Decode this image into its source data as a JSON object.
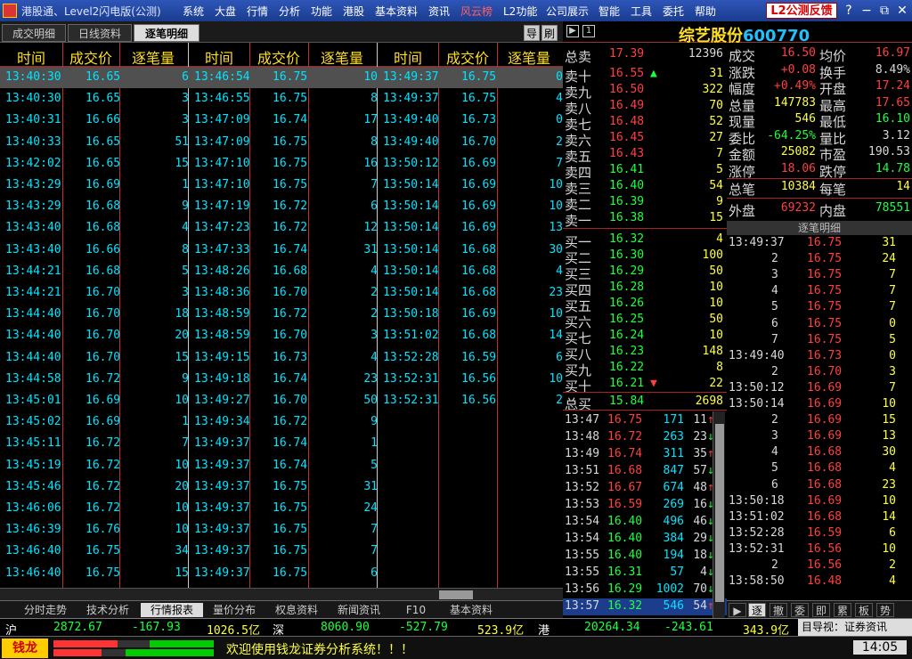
{
  "app": {
    "title": "港股通、Level2闪电版(公测)",
    "menu": [
      "系统",
      "大盘",
      "行情",
      "分析",
      "功能",
      "港股",
      "基本资料",
      "资讯",
      "风云榜",
      "L2功能",
      "公司展示",
      "智能",
      "工具",
      "委托",
      "帮助"
    ],
    "feedback": "L2公测反馈",
    "help": "?",
    "min": "−",
    "restore": "⧉",
    "close": "✕"
  },
  "tabs": [
    "成交明细",
    "日线资料",
    "逐笔明细"
  ],
  "small_btns": [
    "导",
    "刷"
  ],
  "headers": [
    "时间",
    "成交价",
    "逐笔量",
    "时间",
    "成交价",
    "逐笔量",
    "时间",
    "成交价",
    "逐笔量"
  ],
  "col1": [
    [
      "13:40:30",
      "16.65",
      "6"
    ],
    [
      "13:40:30",
      "16.65",
      "3"
    ],
    [
      "13:40:31",
      "16.66",
      "3"
    ],
    [
      "13:40:33",
      "16.65",
      "51"
    ],
    [
      "13:42:02",
      "16.65",
      "15"
    ],
    [
      "13:43:29",
      "16.69",
      "1"
    ],
    [
      "13:43:29",
      "16.68",
      "9"
    ],
    [
      "13:43:40",
      "16.68",
      "4"
    ],
    [
      "13:43:40",
      "16.66",
      "8"
    ],
    [
      "13:44:21",
      "16.68",
      "5"
    ],
    [
      "13:44:21",
      "16.70",
      "3"
    ],
    [
      "13:44:40",
      "16.70",
      "18"
    ],
    [
      "13:44:40",
      "16.70",
      "20"
    ],
    [
      "13:44:40",
      "16.70",
      "15"
    ],
    [
      "13:44:58",
      "16.72",
      "9"
    ],
    [
      "13:45:01",
      "16.69",
      "10"
    ],
    [
      "13:45:02",
      "16.69",
      "1"
    ],
    [
      "13:45:11",
      "16.72",
      "7"
    ],
    [
      "13:45:19",
      "16.72",
      "10"
    ],
    [
      "13:45:46",
      "16.72",
      "20"
    ],
    [
      "13:46:06",
      "16.72",
      "10"
    ],
    [
      "13:46:39",
      "16.76",
      "10"
    ],
    [
      "13:46:40",
      "16.75",
      "34"
    ],
    [
      "13:46:40",
      "16.75",
      "15"
    ]
  ],
  "col2": [
    [
      "13:46:54",
      "16.75",
      "10"
    ],
    [
      "13:46:55",
      "16.75",
      "8"
    ],
    [
      "13:47:09",
      "16.74",
      "17"
    ],
    [
      "13:47:09",
      "16.75",
      "8"
    ],
    [
      "13:47:10",
      "16.75",
      "16"
    ],
    [
      "13:47:10",
      "16.75",
      "7"
    ],
    [
      "13:47:19",
      "16.72",
      "6"
    ],
    [
      "13:47:23",
      "16.72",
      "12"
    ],
    [
      "13:47:33",
      "16.74",
      "31"
    ],
    [
      "13:48:26",
      "16.68",
      "4"
    ],
    [
      "13:48:36",
      "16.70",
      "2"
    ],
    [
      "13:48:59",
      "16.72",
      "2"
    ],
    [
      "13:48:59",
      "16.70",
      "3"
    ],
    [
      "13:49:15",
      "16.73",
      "4"
    ],
    [
      "13:49:18",
      "16.74",
      "23"
    ],
    [
      "13:49:27",
      "16.70",
      "50"
    ],
    [
      "13:49:34",
      "16.72",
      "9"
    ],
    [
      "13:49:37",
      "16.74",
      "1"
    ],
    [
      "13:49:37",
      "16.74",
      "5"
    ],
    [
      "13:49:37",
      "16.75",
      "31"
    ],
    [
      "13:49:37",
      "16.75",
      "24"
    ],
    [
      "13:49:37",
      "16.75",
      "7"
    ],
    [
      "13:49:37",
      "16.75",
      "7"
    ],
    [
      "13:49:37",
      "16.75",
      "6"
    ]
  ],
  "col3": [
    [
      "13:49:37",
      "16.75",
      "0"
    ],
    [
      "13:49:37",
      "16.75",
      "4"
    ],
    [
      "13:49:40",
      "16.73",
      "0"
    ],
    [
      "13:49:40",
      "16.70",
      "2"
    ],
    [
      "13:50:12",
      "16.69",
      "7"
    ],
    [
      "13:50:14",
      "16.69",
      "10"
    ],
    [
      "13:50:14",
      "16.69",
      "10"
    ],
    [
      "13:50:14",
      "16.69",
      "13"
    ],
    [
      "13:50:14",
      "16.68",
      "30"
    ],
    [
      "13:50:14",
      "16.68",
      "4"
    ],
    [
      "13:50:14",
      "16.68",
      "23"
    ],
    [
      "13:50:18",
      "16.69",
      "10"
    ],
    [
      "13:51:02",
      "16.68",
      "14"
    ],
    [
      "13:52:28",
      "16.59",
      "6"
    ],
    [
      "13:52:31",
      "16.56",
      "10"
    ],
    [
      "13:52:31",
      "16.56",
      "2"
    ]
  ],
  "stock": {
    "name": "综艺股份",
    "code": "600770"
  },
  "sell_total": {
    "label": "总卖",
    "price": "17.39",
    "vol": "12396"
  },
  "asks": [
    [
      "卖十",
      "16.55",
      "31"
    ],
    [
      "卖九",
      "16.50",
      "322"
    ],
    [
      "卖八",
      "16.49",
      "70"
    ],
    [
      "卖七",
      "16.48",
      "52"
    ],
    [
      "卖六",
      "16.45",
      "27"
    ],
    [
      "卖五",
      "16.43",
      "7"
    ],
    [
      "卖四",
      "16.41",
      "5"
    ],
    [
      "卖三",
      "16.40",
      "54"
    ],
    [
      "卖二",
      "16.39",
      "9"
    ],
    [
      "卖一",
      "16.38",
      "15"
    ]
  ],
  "bids": [
    [
      "买一",
      "16.32",
      "4"
    ],
    [
      "买二",
      "16.30",
      "100"
    ],
    [
      "买三",
      "16.29",
      "50"
    ],
    [
      "买四",
      "16.28",
      "10"
    ],
    [
      "买五",
      "16.26",
      "10"
    ],
    [
      "买六",
      "16.25",
      "50"
    ],
    [
      "买七",
      "16.24",
      "10"
    ],
    [
      "买八",
      "16.23",
      "148"
    ],
    [
      "买九",
      "16.22",
      "8"
    ],
    [
      "买十",
      "16.21",
      "22"
    ]
  ],
  "buy_total": {
    "label": "总买",
    "price": "15.84",
    "vol": "2698"
  },
  "stats": [
    [
      "成交",
      "16.50",
      "均价",
      "16.97"
    ],
    [
      "涨跌",
      "+0.08",
      "换手",
      "8.49%"
    ],
    [
      "幅度",
      "+0.49%",
      "开盘",
      "17.24"
    ],
    [
      "总量",
      "147783",
      "最高",
      "17.65"
    ],
    [
      "现量",
      "546",
      "最低",
      "16.10"
    ],
    [
      "委比",
      "-64.25%",
      "量比",
      "3.12"
    ],
    [
      "金额",
      "25082",
      "市盈",
      "190.53"
    ],
    [
      "涨停",
      "18.06",
      "跌停",
      "14.78"
    ]
  ],
  "zongbi": [
    "总笔",
    "10384",
    "每笔",
    "14"
  ],
  "waipan": [
    "外盘",
    "69232",
    "内盘",
    "78551"
  ],
  "sub_title": "逐笔明细",
  "ticks": [
    [
      "13:49:37",
      "16.75",
      "31"
    ],
    [
      "2",
      "16.75",
      "24"
    ],
    [
      "3",
      "16.75",
      "7"
    ],
    [
      "4",
      "16.75",
      "7"
    ],
    [
      "5",
      "16.75",
      "7"
    ],
    [
      "6",
      "16.75",
      "0"
    ],
    [
      "7",
      "16.75",
      "5"
    ],
    [
      "13:49:40",
      "16.73",
      "0"
    ],
    [
      "2",
      "16.70",
      "3"
    ],
    [
      "13:50:12",
      "16.69",
      "7"
    ],
    [
      "13:50:14",
      "16.69",
      "10"
    ],
    [
      "2",
      "16.69",
      "15"
    ],
    [
      "3",
      "16.69",
      "13"
    ],
    [
      "4",
      "16.68",
      "30"
    ],
    [
      "5",
      "16.68",
      "4"
    ],
    [
      "6",
      "16.68",
      "23"
    ],
    [
      "13:50:18",
      "16.69",
      "10"
    ],
    [
      "13:51:02",
      "16.68",
      "14"
    ],
    [
      "13:52:28",
      "16.59",
      "6"
    ],
    [
      "13:52:31",
      "16.56",
      "10"
    ],
    [
      "2",
      "16.56",
      "2"
    ],
    [
      "13:58:50",
      "16.48",
      "4"
    ]
  ],
  "hist": [
    [
      "13:47",
      "16.75",
      "171",
      "11"
    ],
    [
      "13:48",
      "16.72",
      "263",
      "23"
    ],
    [
      "13:49",
      "16.74",
      "311",
      "35"
    ],
    [
      "13:51",
      "16.68",
      "847",
      "57"
    ],
    [
      "13:52",
      "16.67",
      "674",
      "48"
    ],
    [
      "13:53",
      "16.59",
      "269",
      "16"
    ],
    [
      "13:54",
      "16.40",
      "496",
      "46"
    ],
    [
      "13:54",
      "16.40",
      "384",
      "29"
    ],
    [
      "13:55",
      "16.40",
      "194",
      "18"
    ],
    [
      "13:55",
      "16.31",
      "57",
      "4"
    ],
    [
      "13:56",
      "16.29",
      "1002",
      "70"
    ],
    [
      "13:57",
      "16.32",
      "546",
      "54"
    ]
  ],
  "btabs": [
    "分时走势",
    "技术分析",
    "行情报表",
    "量价分布",
    "权息资料",
    "新闻资讯",
    "F10",
    "基本资料"
  ],
  "rtabs": [
    "逐",
    "撤",
    "委",
    "即",
    "累",
    "板",
    "势"
  ],
  "indices": [
    {
      "name": "沪",
      "val": "2872.67",
      "chg": "-167.93",
      "amt": "1026.5亿"
    },
    {
      "name": "深",
      "val": "8060.90",
      "chg": "-527.79",
      "amt": "523.9亿"
    },
    {
      "name": "港",
      "val": "20264.34",
      "chg": "-243.61",
      "amt": "343.9亿"
    }
  ],
  "daoshi": "目导视：证券资讯",
  "logo": "钱龙",
  "welcome": "欢迎使用钱龙证券分析系统！！！",
  "clock": "14:05"
}
